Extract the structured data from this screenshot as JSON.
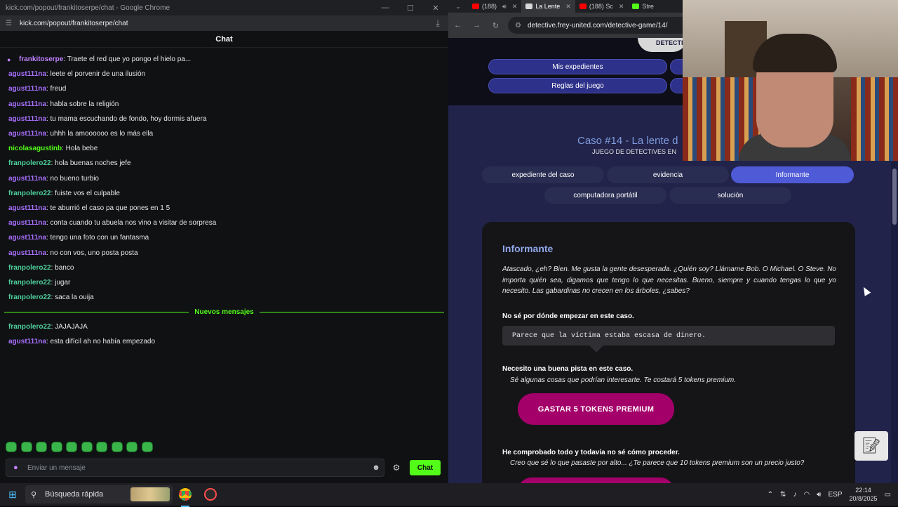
{
  "left_window": {
    "title": "kick.com/popout/frankitoserpe/chat - Google Chrome",
    "url": "kick.com/popout/frankitoserpe/chat",
    "chat_header": "Chat",
    "messages": [
      {
        "user": "frankitoserpe",
        "text": ": Traete el red que yo pongo el hielo pa...",
        "color": "#c080ff",
        "pinned": true
      },
      {
        "user": "agust111na",
        "text": ": leete el porvenir de una ilusión",
        "color": "#a970ff"
      },
      {
        "user": "agust111na",
        "text": ": freud",
        "color": "#a970ff"
      },
      {
        "user": "agust111na",
        "text": ": habla sobre la religión",
        "color": "#a970ff"
      },
      {
        "user": "agust111na",
        "text": ": tu mama escuchando de fondo, hoy dormis afuera",
        "color": "#a970ff"
      },
      {
        "user": "agust111na",
        "text": ": uhhh la amoooooo es lo más ella",
        "color": "#a970ff"
      },
      {
        "user": "nicolasagustinb",
        "text": ": Hola bebe",
        "color": "#53fc18"
      },
      {
        "user": "franpolero22",
        "text": ": hola buenas noches jefe",
        "color": "#4ecf9a"
      },
      {
        "user": "agust111na",
        "text": ": no bueno turbio",
        "color": "#a970ff"
      },
      {
        "user": "franpolero22",
        "text": ": fuiste vos el culpable",
        "color": "#4ecf9a"
      },
      {
        "user": "agust111na",
        "text": ": te aburrió el caso pa que pones en 1 5",
        "color": "#a970ff"
      },
      {
        "user": "agust111na",
        "text": ": conta cuando tu abuela nos vino a visitar de sorpresa",
        "color": "#a970ff"
      },
      {
        "user": "agust111na",
        "text": ": tengo una foto con un fantasma",
        "color": "#a970ff"
      },
      {
        "user": "agust111na",
        "text": ": no con vos, uno posta posta",
        "color": "#a970ff"
      },
      {
        "user": "franpolero22",
        "text": ": banco",
        "color": "#4ecf9a"
      },
      {
        "user": "franpolero22",
        "text": ": jugar",
        "color": "#4ecf9a"
      },
      {
        "user": "franpolero22",
        "text": ": saca la ouija",
        "color": "#4ecf9a"
      }
    ],
    "new_messages_label": "Nuevos mensajes",
    "new_messages": [
      {
        "user": "franpolero22",
        "text": ": JAJAJAJA",
        "color": "#4ecf9a"
      },
      {
        "user": "agust111na",
        "text": ": esta difícil ah no había empezado",
        "color": "#a970ff"
      }
    ],
    "input_placeholder": "Enviar un mensaje",
    "send_label": "Chat",
    "emote_count": 10
  },
  "right_window": {
    "tabs": [
      {
        "label": "(188)",
        "color": "#ff0000"
      },
      {
        "label": "La Lente",
        "color": "#e0e0e0",
        "active": true
      },
      {
        "label": "(188) Sc",
        "color": "#ff0000"
      },
      {
        "label": "Stre",
        "color": "#53fc18"
      }
    ],
    "url": "detective.frey-united.com/detective-game/14/",
    "logo_text": "DETECTI",
    "nav": {
      "expedientes": "Mis expedientes",
      "reglas": "Reglas del juego"
    },
    "case_title": "Caso #14 - La lente d",
    "case_subtitle": "JUEGO DE DETECTIVES EN",
    "case_tabs": [
      "expediente del caso",
      "evidencia",
      "Informante",
      "computadora portátil",
      "solución"
    ],
    "active_tab": "Informante",
    "card": {
      "heading": "Informante",
      "intro": "Atascado, ¿eh? Bien. Me gusta la gente desesperada. ¿Quién soy? Llámame Bob. O Michael. O Steve. No importa quién sea, digamos que tengo lo que necesitas. Bueno, siempre y cuando tengas lo que yo necesito. Las gabardinas no crecen en los árboles, ¿sabes?",
      "q1": "No sé por dónde empezar en este caso.",
      "a1": "Parece que la víctima estaba escasa de dinero.",
      "q2": "Necesito una buena pista en este caso.",
      "a2": "Sé algunas cosas que podrían interesarte. Te costará 5 tokens premium.",
      "buy_label": "GASTAR 5 TOKENS PREMIUM",
      "q3": "He comprobado todo y todavía no sé cómo proceder.",
      "a3": "Creo que sé lo que pasaste por alto... ¿Te parece que 10 tokens premium son un precio justo?"
    }
  },
  "taskbar": {
    "search_label": "Búsqueda rápida",
    "lang": "ESP",
    "time": "22:14",
    "date": "20/8/2025"
  }
}
